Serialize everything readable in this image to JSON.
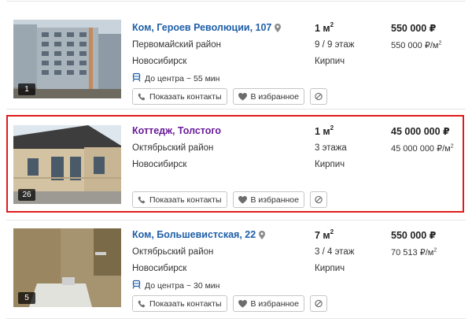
{
  "listings": [
    {
      "title": "Ком, Героев Революции, 107",
      "district": "Первомайский район",
      "city": "Новосибирск",
      "transit": "До центра ~ 55 мин",
      "area_value": "1 м",
      "area_unit_sup": "2",
      "floors": "9 / 9 этаж",
      "material": "Кирпич",
      "price": "550 000 ₽",
      "price_per_m2": "550 000 ₽/м",
      "price_per_m2_sup": "2",
      "photo_count": "1",
      "show_contacts_label": "Показать контакты",
      "favorite_label": "В избранное"
    },
    {
      "title": "Коттедж, Толстого",
      "district": "Октябрьский район",
      "city": "Новосибирск",
      "area_value": "1 м",
      "area_unit_sup": "2",
      "floors": "3 этажа",
      "material": "Кирпич",
      "price": "45 000 000 ₽",
      "price_per_m2": "45 000 000 ₽/м",
      "price_per_m2_sup": "2",
      "photo_count": "26",
      "show_contacts_label": "Показать контакты",
      "favorite_label": "В избранное"
    },
    {
      "title": "Ком, Большевистская, 22",
      "district": "Октябрьский район",
      "city": "Новосибирск",
      "transit": "До центра ~ 30 мин",
      "area_value": "7 м",
      "area_unit_sup": "2",
      "floors": "3 / 4 этаж",
      "material": "Кирпич",
      "price": "550 000 ₽",
      "price_per_m2": "70 513 ₽/м",
      "price_per_m2_sup": "2",
      "photo_count": "5",
      "show_contacts_label": "Показать контакты",
      "favorite_label": "В избранное"
    }
  ],
  "colors": {
    "link": "#1f5fa8",
    "visited_link": "#6a1b9a",
    "highlight_border": "#e01b1b"
  },
  "icons": {
    "location": "map-pin-icon",
    "transit": "tram-icon",
    "phone": "phone-icon",
    "favorite": "heart-icon",
    "hide": "block-icon"
  }
}
